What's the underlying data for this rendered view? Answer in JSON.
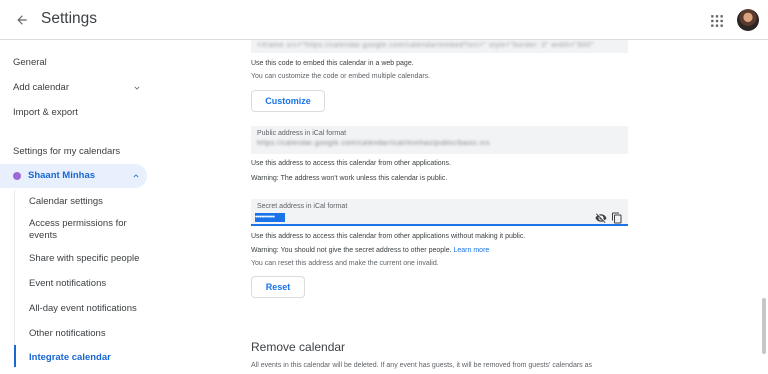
{
  "header": {
    "title": "Settings",
    "back_icon": "arrow-back-icon",
    "apps_icon": "apps-grid-icon"
  },
  "sidebar": {
    "items": [
      {
        "label": "General"
      },
      {
        "label": "Add calendar"
      },
      {
        "label": "Import & export"
      }
    ],
    "section_heading": "Settings for my calendars",
    "calendar": {
      "name": "Shaant Minhas",
      "color": "#9e69d5",
      "sub_items": [
        {
          "label": "Calendar settings"
        },
        {
          "label": "Access permissions for events"
        },
        {
          "label": "Share with specific people"
        },
        {
          "label": "Event notifications"
        },
        {
          "label": "All-day event notifications"
        },
        {
          "label": "Other notifications"
        },
        {
          "label": "Integrate calendar"
        }
      ]
    }
  },
  "main": {
    "embed": {
      "help": "Use this code to embed this calendar in a web page.",
      "help2": "You can customize the code or embed multiple calendars.",
      "button": "Customize"
    },
    "public_address": {
      "label": "Public address in iCal format",
      "help": "Use this address to access this calendar from other applications.",
      "warning": "Warning: The address won't work unless this calendar is public."
    },
    "secret_address": {
      "label": "Secret address in iCal format",
      "value": "••••••••••",
      "help": "Use this address to access this calendar from other applications without making it public.",
      "warning": "Warning: You should not give the secret address to other people.",
      "learn_more": "Learn more",
      "reset_help": "You can reset this address and make the current one invalid.",
      "reset_button": "Reset"
    },
    "remove": {
      "title": "Remove calendar",
      "help": "All events in this calendar will be deleted. If any event has guests, it will be removed from guests' calendars as"
    }
  },
  "colors": {
    "accent": "#1a73e8",
    "active_bg": "#e8f0fe",
    "field_bg": "#f1f3f4"
  }
}
